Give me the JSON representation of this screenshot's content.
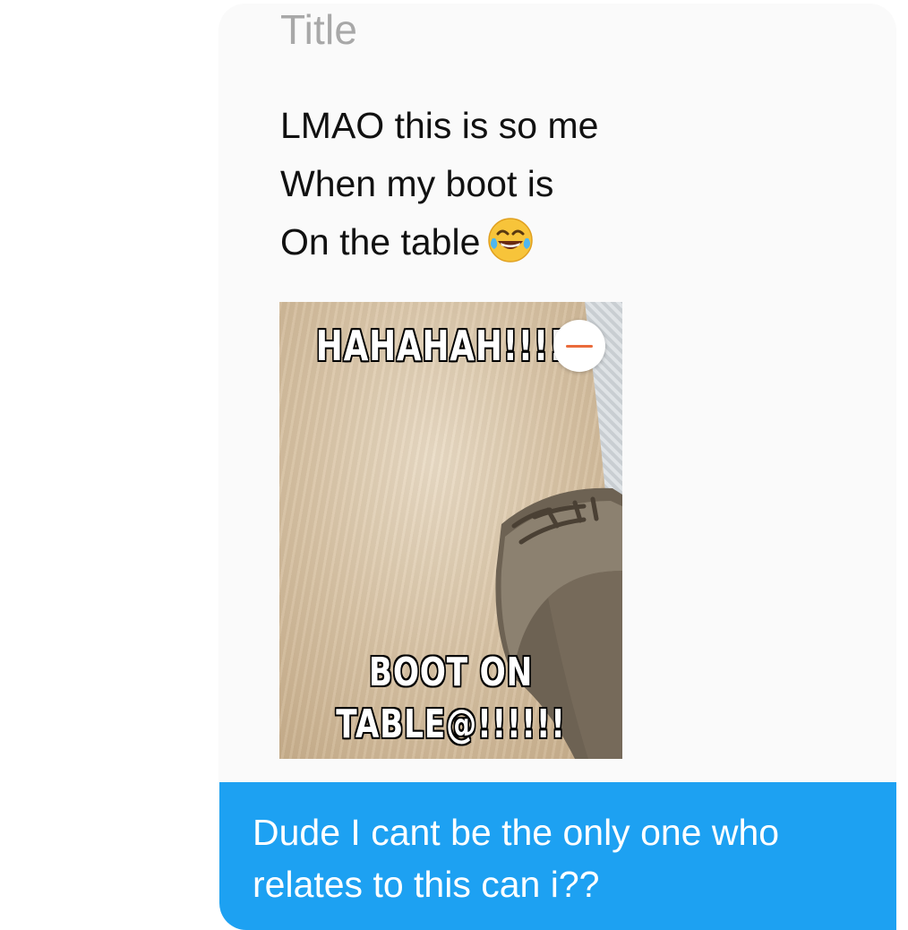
{
  "compose": {
    "title_placeholder": "Title",
    "message_lines": [
      "LMAO this is so me",
      "When my boot is",
      "On the table"
    ],
    "emoji": "face-with-tears-of-joy"
  },
  "attachment": {
    "meme_top_text": "HAHAHAH!!!!",
    "meme_bottom_line1": "BOOT ON",
    "meme_bottom_line2": "TABLE@!!!!!!",
    "remove_icon": "minus-circle-icon"
  },
  "sent_message": {
    "text": "Dude I cant be the only one who relates to this can i??",
    "bubble_color": "#1da1f2"
  },
  "colors": {
    "card_background": "#fafafa",
    "placeholder": "#a8a8a8",
    "remove_accent": "#ea6b3b"
  }
}
